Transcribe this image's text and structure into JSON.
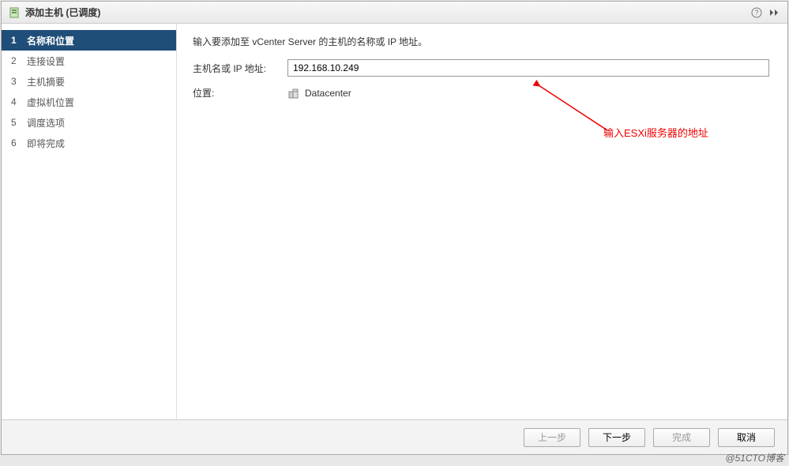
{
  "titlebar": {
    "title": "添加主机 (已调度)"
  },
  "sidebar": {
    "steps": [
      {
        "num": "1",
        "label": "名称和位置",
        "active": true
      },
      {
        "num": "2",
        "label": "连接设置",
        "active": false
      },
      {
        "num": "3",
        "label": "主机摘要",
        "active": false
      },
      {
        "num": "4",
        "label": "虚拟机位置",
        "active": false
      },
      {
        "num": "5",
        "label": "调度选项",
        "active": false
      },
      {
        "num": "6",
        "label": "即将完成",
        "active": false
      }
    ]
  },
  "main": {
    "instruction": "输入要添加至 vCenter Server 的主机的名称或 IP 地址。",
    "host_label": "主机名或 IP 地址:",
    "host_value": "192.168.10.249",
    "location_label": "位置:",
    "location_value": "Datacenter",
    "annotation_text": "输入ESXi服务器的地址"
  },
  "footer": {
    "back": "上一步",
    "next": "下一步",
    "finish": "完成",
    "cancel": "取消"
  },
  "watermark": "@51CTO博客"
}
